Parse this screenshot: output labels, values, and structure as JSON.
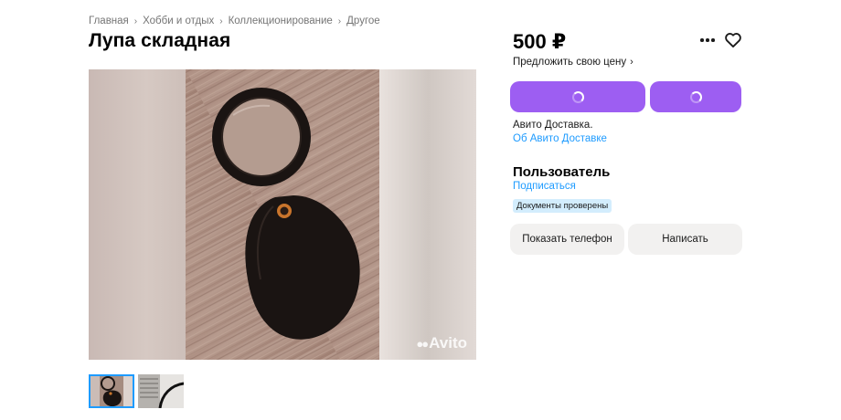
{
  "breadcrumb": [
    "Главная",
    "Хобби и отдых",
    "Коллекционирование",
    "Другое"
  ],
  "title": "Лупа складная",
  "gallery": {
    "watermark": "Avito",
    "thumbnail_count": 2,
    "active_thumbnail": 1
  },
  "price": "500 ₽",
  "offer_price": "Предложить свою цену",
  "icons": {
    "more": "more-dots-icon",
    "favorite": "heart-icon",
    "loading": "spinner-icon",
    "chevron": "chevron-right-icon"
  },
  "delivery": {
    "text": "Авито Доставка.",
    "link": "Об Авито Доставке"
  },
  "seller": {
    "name": "Пользователь",
    "subscribe": "Подписаться",
    "badge": "Документы проверены"
  },
  "actions": {
    "show_phone": "Показать телефон",
    "write": "Написать"
  },
  "colors": {
    "accent": "#9d5ef2",
    "link": "#1e9bff",
    "badge_bg": "#d3edfd",
    "grey_button": "#f2f1f0"
  }
}
